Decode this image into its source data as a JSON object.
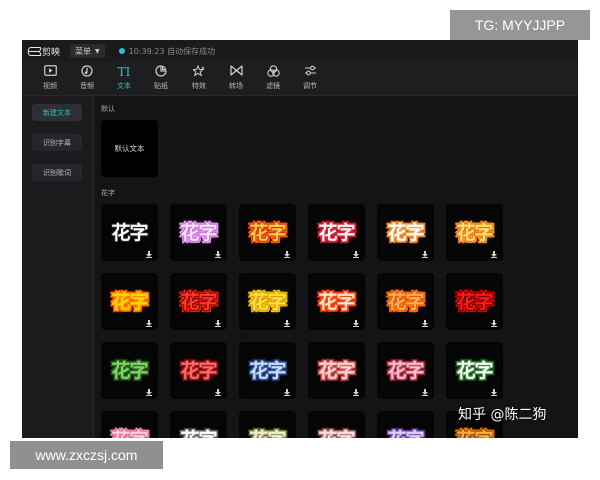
{
  "app": {
    "name": "剪映",
    "menu_label": "菜单",
    "save_status": "10:39:23 自动保存成功"
  },
  "toolbar": {
    "items": [
      {
        "label": "视频",
        "icon": "video-icon",
        "active": false
      },
      {
        "label": "音频",
        "icon": "audio-icon",
        "active": false
      },
      {
        "label": "文本",
        "icon": "text-icon",
        "active": true
      },
      {
        "label": "贴纸",
        "icon": "sticker-icon",
        "active": false
      },
      {
        "label": "特效",
        "icon": "effects-icon",
        "active": false
      },
      {
        "label": "转场",
        "icon": "transition-icon",
        "active": false
      },
      {
        "label": "滤镜",
        "icon": "filter-icon",
        "active": false
      },
      {
        "label": "调节",
        "icon": "adjust-icon",
        "active": false
      }
    ]
  },
  "sidebar": {
    "items": [
      {
        "label": "新建文本",
        "active": true
      },
      {
        "label": "识别字幕",
        "active": false
      },
      {
        "label": "识别歌词",
        "active": false
      }
    ]
  },
  "content": {
    "default_section": "默认",
    "default_card_label": "默认文本",
    "fancy_section": "花字",
    "fancy_text": "花字",
    "fancy_tiles": [
      {
        "fill": "#ffffff",
        "stroke": "#222222",
        "glow": "#000000"
      },
      {
        "fill": "#f3e6ff",
        "stroke": "#d06fd4",
        "glow": "#e9a0ff"
      },
      {
        "fill": "#ffd23f",
        "stroke": "#e0301e",
        "glow": "#ff6a00"
      },
      {
        "fill": "#ffffff",
        "stroke": "#e0223a",
        "glow": "#c01a2e"
      },
      {
        "fill": "#ffffff",
        "stroke": "#f0a040",
        "glow": "#e07a20"
      },
      {
        "fill": "#ffe27a",
        "stroke": "#f07a10",
        "glow": "#ff9a30"
      },
      {
        "fill": "#ffd700",
        "stroke": "#ff8a00",
        "glow": "#ff5a00"
      },
      {
        "fill": "#ff3a2a",
        "stroke": "#8a0000",
        "glow": "#ff2a00"
      },
      {
        "fill": "#ffe14a",
        "stroke": "#e0a000",
        "glow": "#ffcc00"
      },
      {
        "fill": "#ffe8d0",
        "stroke": "#ff4a1a",
        "glow": "#ff3000"
      },
      {
        "fill": "#ffb060",
        "stroke": "#e85a00",
        "glow": "#ff7a00"
      },
      {
        "fill": "#ff1a1a",
        "stroke": "#6a0000",
        "glow": "#ff0000"
      },
      {
        "fill": "#7fd46a",
        "stroke": "#2f6a20",
        "glow": "#1e3a14"
      },
      {
        "fill": "#ff6a6a",
        "stroke": "#a01a1a",
        "glow": "#5a0a0a"
      },
      {
        "fill": "#c8dcff",
        "stroke": "#3a5aa0",
        "glow": "#1a2a50"
      },
      {
        "fill": "#ffd6d6",
        "stroke": "#e05a5a",
        "glow": "#8a2a2a"
      },
      {
        "fill": "#ffc0cc",
        "stroke": "#c0405a",
        "glow": "#6a1a2a"
      },
      {
        "fill": "#ffffff",
        "stroke": "#3a8a3a",
        "glow": "#1a4a1a"
      },
      {
        "fill": "#ffd0e0",
        "stroke": "#e070a0",
        "glow": "#ff90c0"
      },
      {
        "fill": "#ffffff",
        "stroke": "#888888",
        "glow": "#333333"
      },
      {
        "fill": "#f0f0d0",
        "stroke": "#a0a060",
        "glow": "#505020"
      },
      {
        "fill": "#ffe0e0",
        "stroke": "#c08080",
        "glow": "#603030"
      },
      {
        "fill": "#e0d0ff",
        "stroke": "#8060c0",
        "glow": "#402060"
      },
      {
        "fill": "#ffb040",
        "stroke": "#a05000",
        "glow": "#ff8000"
      }
    ]
  },
  "watermarks": {
    "top_right": "TG: MYYJJPP",
    "bottom_left": "www.zxczsj.com",
    "zhihu": "知乎 @陈二狗"
  }
}
